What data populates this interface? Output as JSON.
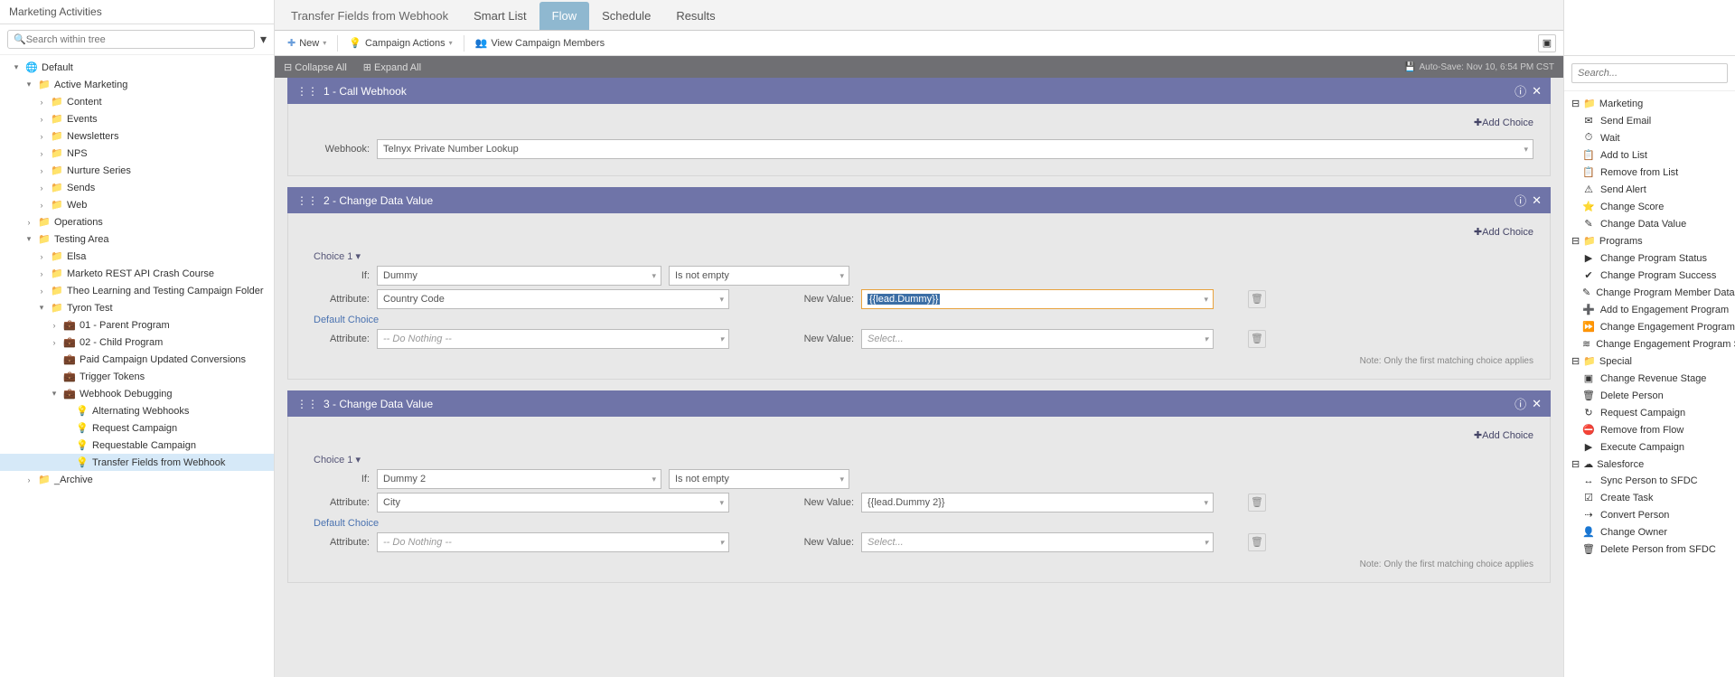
{
  "leftHeader": "Marketing Activities",
  "searchPlaceholder": "Search within tree",
  "tree": {
    "root": "Default",
    "am": "Active Marketing",
    "content": "Content",
    "events": "Events",
    "newsletters": "Newsletters",
    "nps": "NPS",
    "nurture": "Nurture Series",
    "sends": "Sends",
    "web": "Web",
    "operations": "Operations",
    "testing": "Testing Area",
    "elsa": "Elsa",
    "crash": "Marketo REST API Crash Course",
    "theo": "Theo Learning and Testing Campaign Folder",
    "tyron": "Tyron Test",
    "p01": "01 - Parent Program",
    "p02": "02 - Child Program",
    "paid": "Paid Campaign Updated Conversions",
    "trigger": "Trigger Tokens",
    "webhook": "Webhook Debugging",
    "alt": "Alternating Webhooks",
    "req": "Request Campaign",
    "reqable": "Requestable Campaign",
    "transfer": "Transfer Fields from Webhook",
    "archive": "_Archive"
  },
  "tabs": {
    "title": "Transfer Fields from Webhook",
    "smart": "Smart List",
    "flow": "Flow",
    "schedule": "Schedule",
    "results": "Results"
  },
  "toolbar": {
    "new": "New",
    "actions": "Campaign Actions",
    "members": "View Campaign Members"
  },
  "subbar": {
    "collapse": "Collapse All",
    "expand": "Expand All",
    "autosave": "Auto-Save: Nov 10, 6:54 PM CST"
  },
  "step1": {
    "title": "1 - Call Webhook",
    "addChoice": "Add Choice",
    "webhookLabel": "Webhook:",
    "webhookValue": "Telnyx Private Number Lookup"
  },
  "step2": {
    "title": "2 - Change Data Value",
    "addChoice": "Add Choice",
    "choice1": "Choice 1 ▾",
    "ifLabel": "If:",
    "ifField": "Dummy",
    "ifOp": "Is not empty",
    "attrLabel": "Attribute:",
    "attrValue": "Country Code",
    "nvLabel": "New Value:",
    "nvValue": "{{lead.Dummy}}",
    "defaultChoice": "Default Choice",
    "doNothing": "-- Do Nothing --",
    "selectPh": "Select...",
    "note": "Note: Only the first matching choice applies"
  },
  "step3": {
    "title": "3 - Change Data Value",
    "addChoice": "Add Choice",
    "choice1": "Choice 1 ▾",
    "ifLabel": "If:",
    "ifField": "Dummy 2",
    "ifOp": "Is not empty",
    "attrLabel": "Attribute:",
    "attrValue": "City",
    "nvLabel": "New Value:",
    "nvValue": "{{lead.Dummy 2}}",
    "defaultChoice": "Default Choice",
    "doNothing": "-- Do Nothing --",
    "selectPh": "Select...",
    "note": "Note: Only the first matching choice applies"
  },
  "right": {
    "searchPh": "Search...",
    "g_marketing": "Marketing",
    "sendEmail": "Send Email",
    "wait": "Wait",
    "addToList": "Add to List",
    "removeList": "Remove from List",
    "sendAlert": "Send Alert",
    "changeScore": "Change Score",
    "changeData": "Change Data Value",
    "g_programs": "Programs",
    "cps": "Change Program Status",
    "cpsu": "Change Program Success",
    "cpmd": "Change Program Member Data",
    "ate": "Add to Engagement Program",
    "cepc": "Change Engagement Program Cadence",
    "ceps": "Change Engagement Program Stream",
    "g_special": "Special",
    "crs": "Change Revenue Stage",
    "dp": "Delete Person",
    "rc": "Request Campaign",
    "rff": "Remove from Flow",
    "ec": "Execute Campaign",
    "g_sfdc": "Salesforce",
    "sps": "Sync Person to SFDC",
    "ct": "Create Task",
    "cp": "Convert Person",
    "co": "Change Owner",
    "dps": "Delete Person from SFDC"
  }
}
